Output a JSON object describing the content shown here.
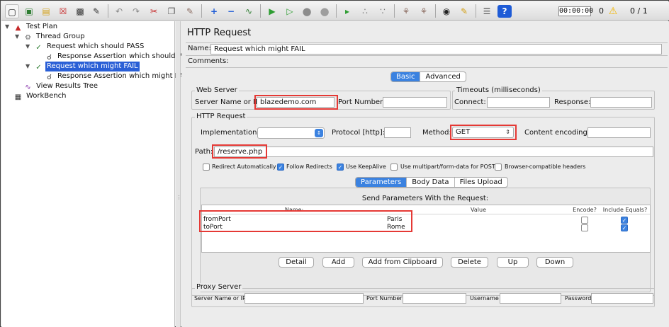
{
  "toolbar": {
    "timer": "00:00:00",
    "error_count": "0",
    "thread_ratio": "0 / 1",
    "icons": [
      "new-icon",
      "templates-icon",
      "open-icon",
      "close-icon",
      "save-icon",
      "save-as-icon",
      "undo-icon",
      "redo-icon",
      "cut-icon",
      "copy-icon",
      "paste-icon",
      "expand-icon",
      "collapse-icon",
      "toggle-icon",
      "start-icon",
      "start-no-pause-icon",
      "stop-icon",
      "shutdown-icon",
      "remote-start-icon",
      "remote-stop-icon",
      "remote-shutdown-icon",
      "clear-icon",
      "clear-all-icon",
      "search-icon",
      "reset-search-icon",
      "function-helper-icon",
      "help-icon",
      "warning-icon"
    ]
  },
  "tree": {
    "test_plan": "Test Plan",
    "thread_group": "Thread Group",
    "request_pass": "Request which should PASS",
    "assertion_pass": "Response Assertion which should PASS",
    "request_fail": "Request which might FAIL",
    "assertion_fail": "Response Assertion which might FAIL",
    "results_tree": "View Results Tree",
    "workbench": "WorkBench"
  },
  "panel": {
    "title": "HTTP Request",
    "name_label": "Name:",
    "name_value": "Request which might FAIL",
    "comments_label": "Comments:",
    "tabs": {
      "basic": "Basic",
      "advanced": "Advanced"
    }
  },
  "web_server": {
    "group_label": "Web Server",
    "server_label": "Server Name or IP:",
    "server_value": "blazedemo.com",
    "port_label": "Port Number:",
    "port_value": ""
  },
  "timeouts": {
    "group_label": "Timeouts (milliseconds)",
    "connect_label": "Connect:",
    "response_label": "Response:"
  },
  "http_request": {
    "group_label": "HTTP Request",
    "implementation_label": "Implementation:",
    "implementation_value": "",
    "protocol_label": "Protocol [http]:",
    "method_label": "Method:",
    "method_value": "GET",
    "encoding_label": "Content encoding:",
    "path_label": "Path:",
    "path_value": "/reserve.php",
    "options": [
      {
        "label": "Redirect Automatically",
        "checked": false
      },
      {
        "label": "Follow Redirects",
        "checked": true
      },
      {
        "label": "Use KeepAlive",
        "checked": true
      },
      {
        "label": "Use multipart/form-data for POST",
        "checked": false
      },
      {
        "label": "Browser-compatible headers",
        "checked": false
      }
    ]
  },
  "params": {
    "tabs": {
      "parameters": "Parameters",
      "body_data": "Body Data",
      "files_upload": "Files Upload"
    },
    "table_title": "Send Parameters With the Request:",
    "columns": {
      "name": "Name:",
      "value": "Value",
      "encode": "Encode?",
      "include": "Include Equals?"
    },
    "rows": [
      {
        "name": "fromPort",
        "value": "Paris",
        "encode": false,
        "include": true
      },
      {
        "name": "toPort",
        "value": "Rome",
        "encode": false,
        "include": true
      }
    ],
    "buttons": {
      "detail": "Detail",
      "add": "Add",
      "add_clipboard": "Add from Clipboard",
      "delete": "Delete",
      "up": "Up",
      "down": "Down"
    }
  },
  "proxy": {
    "group_label": "Proxy Server",
    "server_label": "Server Name or IP:",
    "port_label": "Port Number:",
    "username_label": "Username",
    "password_label": "Password"
  },
  "colors": {
    "highlight": "#e53935",
    "accent": "#3b82e0",
    "selection": "#2a5fd6"
  }
}
